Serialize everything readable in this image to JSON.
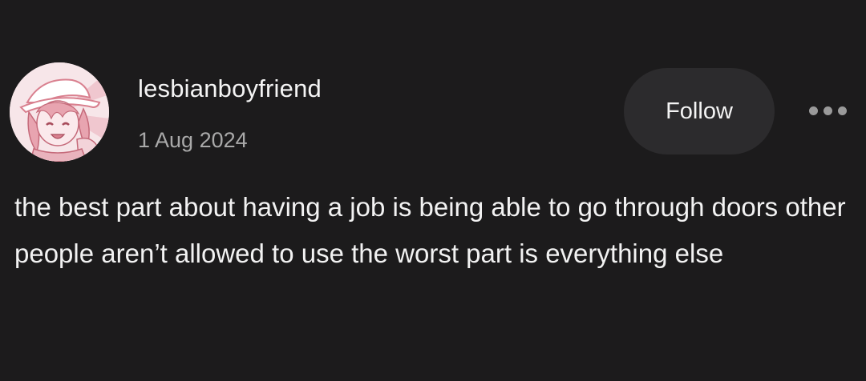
{
  "post": {
    "author": {
      "username": "lesbianboyfriend",
      "date": "1 Aug 2024",
      "avatar_icon": "anime-avatar-icon"
    },
    "actions": {
      "follow_label": "Follow",
      "more_icon": "more-options-icon"
    },
    "body": "the best part about having a job is being able to go through doors other people aren’t allowed to use the worst part is everything else"
  },
  "colors": {
    "background": "#1c1b1c",
    "follow_button_bg": "#2c2b2d",
    "text_primary": "#f2f2f2",
    "text_secondary": "#a9a9a9",
    "avatar_accent": "#d9808f"
  }
}
